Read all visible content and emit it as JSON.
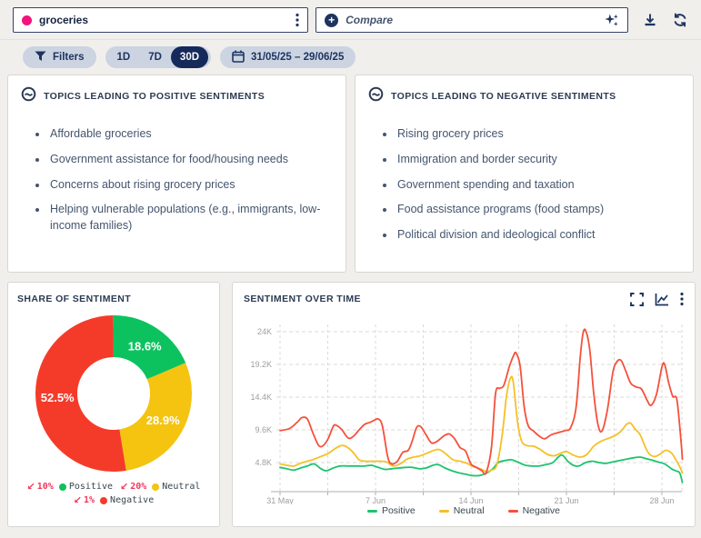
{
  "toolbar": {
    "query": {
      "text": "groceries",
      "dot_color": "#f2137d"
    },
    "compare": {
      "placeholder": "Compare"
    },
    "icons": {
      "query_menu": "kebab-vertical",
      "compare_add": "plus-circle",
      "compare_ai": "sparkles",
      "download": "download-tray",
      "refresh": "refresh-arrows"
    }
  },
  "filters": {
    "filters_label": "Filters",
    "ranges": [
      {
        "label": "1D",
        "active": false
      },
      {
        "label": "7D",
        "active": false
      },
      {
        "label": "30D",
        "active": true
      }
    ],
    "date_range": "31/05/25 – 29/06/25"
  },
  "topics_positive": {
    "title": "TOPICS LEADING TO POSITIVE SENTIMENTS",
    "items": [
      "Affordable groceries",
      "Government assistance for food/housing needs",
      "Concerns about rising grocery prices",
      "Helping vulnerable populations (e.g., immigrants, low-income families)"
    ]
  },
  "topics_negative": {
    "title": "TOPICS LEADING TO NEGATIVE SENTIMENTS",
    "items": [
      "Rising grocery prices",
      "Immigration and border security",
      "Government spending and taxation",
      "Food assistance programs (food stamps)",
      "Political division and ideological conflict"
    ]
  },
  "share_of_sentiment": {
    "title": "SHARE OF SENTIMENT",
    "arrow_glyph": "↙",
    "change_color": "#f5365c",
    "legend": [
      {
        "change": "10%",
        "direction": "down",
        "label": "Positive",
        "color": "#0cc25f"
      },
      {
        "change": "20%",
        "direction": "down",
        "label": "Neutral",
        "color": "#f4c411"
      },
      {
        "change": "1%",
        "direction": "down",
        "label": "Negative",
        "color": "#f43b2a"
      }
    ]
  },
  "sentiment_over_time": {
    "title": "SENTIMENT OVER TIME"
  },
  "chart_data": [
    {
      "type": "pie",
      "variant": "donut",
      "title": "SHARE OF SENTIMENT",
      "value_format": "percent",
      "slices": [
        {
          "label": "Positive",
          "value": 18.6,
          "color": "#0cc25f"
        },
        {
          "label": "Neutral",
          "value": 28.9,
          "color": "#f4c411"
        },
        {
          "label": "Negative",
          "value": 52.5,
          "color": "#f43b2a"
        }
      ],
      "labels_shown": [
        "18.6%",
        "28.9%",
        "52.5%"
      ]
    },
    {
      "type": "line",
      "title": "SENTIMENT OVER TIME",
      "x_unit": "days from 31 May 2025",
      "y_unit": "K mentions",
      "xlim": [
        0,
        29.5
      ],
      "ylim": [
        0.4,
        25.5
      ],
      "grid": "dashed",
      "legend_position": "bottom",
      "x_ticks": [
        {
          "d": 0,
          "label": "31 May"
        },
        {
          "d": 7,
          "label": "7 Jun"
        },
        {
          "d": 14,
          "label": "14 Jun"
        },
        {
          "d": 21,
          "label": "21 Jun"
        },
        {
          "d": 28,
          "label": "28 Jun"
        }
      ],
      "y_ticks": [
        {
          "v": 4.8,
          "label": "4.8K"
        },
        {
          "v": 9.6,
          "label": "9.6K"
        },
        {
          "v": 14.4,
          "label": "14.4K"
        },
        {
          "v": 19.2,
          "label": "19.2K"
        },
        {
          "v": 24,
          "label": "24K"
        }
      ],
      "series": [
        {
          "name": "Positive",
          "color": "#1cc46e",
          "points": [
            [
              0,
              4.1
            ],
            [
              0.5,
              3.9
            ],
            [
              1,
              3.7
            ],
            [
              1.5,
              4.0
            ],
            [
              2,
              4.3
            ],
            [
              2.5,
              4.6
            ],
            [
              3,
              3.9
            ],
            [
              3.4,
              3.6
            ],
            [
              3.9,
              4.0
            ],
            [
              4.4,
              4.3
            ],
            [
              5,
              4.3
            ],
            [
              5.6,
              4.3
            ],
            [
              6.2,
              4.3
            ],
            [
              6.7,
              4.4
            ],
            [
              7.2,
              4.1
            ],
            [
              7.7,
              3.8
            ],
            [
              8.2,
              3.9
            ],
            [
              8.7,
              4.0
            ],
            [
              9.2,
              4.1
            ],
            [
              9.7,
              4.1
            ],
            [
              10.2,
              3.9
            ],
            [
              10.7,
              4.0
            ],
            [
              11.2,
              4.4
            ],
            [
              11.6,
              4.5
            ],
            [
              12.1,
              4.0
            ],
            [
              12.6,
              3.6
            ],
            [
              13.1,
              3.3
            ],
            [
              13.6,
              3.1
            ],
            [
              14.1,
              2.9
            ],
            [
              14.6,
              2.9
            ],
            [
              15.1,
              3.2
            ],
            [
              15.6,
              3.9
            ],
            [
              16,
              4.8
            ],
            [
              16.5,
              5.1
            ],
            [
              17,
              5.2
            ],
            [
              17.5,
              4.8
            ],
            [
              18,
              4.4
            ],
            [
              18.5,
              4.3
            ],
            [
              19,
              4.3
            ],
            [
              19.5,
              4.5
            ],
            [
              20,
              4.8
            ],
            [
              20.4,
              5.6
            ],
            [
              20.7,
              5.9
            ],
            [
              21.1,
              5.0
            ],
            [
              21.5,
              4.4
            ],
            [
              21.9,
              4.3
            ],
            [
              22.4,
              4.8
            ],
            [
              22.9,
              5.0
            ],
            [
              23.4,
              4.8
            ],
            [
              23.9,
              4.7
            ],
            [
              24.4,
              4.9
            ],
            [
              24.9,
              5.1
            ],
            [
              25.4,
              5.3
            ],
            [
              25.9,
              5.5
            ],
            [
              26.4,
              5.6
            ],
            [
              26.8,
              5.4
            ],
            [
              27.2,
              5.2
            ],
            [
              27.7,
              4.9
            ],
            [
              28.2,
              4.6
            ],
            [
              28.7,
              3.9
            ],
            [
              29,
              3.6
            ],
            [
              29.3,
              3.3
            ],
            [
              29.5,
              1.9
            ]
          ]
        },
        {
          "name": "Neutral",
          "color": "#f5c028",
          "points": [
            [
              0,
              4.6
            ],
            [
              0.5,
              4.4
            ],
            [
              1,
              4.3
            ],
            [
              1.5,
              4.7
            ],
            [
              2,
              5.0
            ],
            [
              2.5,
              5.3
            ],
            [
              3,
              5.7
            ],
            [
              3.5,
              6.1
            ],
            [
              4,
              6.8
            ],
            [
              4.5,
              7.3
            ],
            [
              4.9,
              7.1
            ],
            [
              5.4,
              6.2
            ],
            [
              5.8,
              5.2
            ],
            [
              6.3,
              5.0
            ],
            [
              6.8,
              5.0
            ],
            [
              7.3,
              5.0
            ],
            [
              7.8,
              4.9
            ],
            [
              8.3,
              4.3
            ],
            [
              8.8,
              4.6
            ],
            [
              9.3,
              5.3
            ],
            [
              9.8,
              5.6
            ],
            [
              10.3,
              5.8
            ],
            [
              10.8,
              6.2
            ],
            [
              11.3,
              6.6
            ],
            [
              11.7,
              6.7
            ],
            [
              12.2,
              6.0
            ],
            [
              12.7,
              5.2
            ],
            [
              13.2,
              5.0
            ],
            [
              13.7,
              4.7
            ],
            [
              14.2,
              4.2
            ],
            [
              14.7,
              3.9
            ],
            [
              15.1,
              3.5
            ],
            [
              15.5,
              3.7
            ],
            [
              15.9,
              4.5
            ],
            [
              16.3,
              9.0
            ],
            [
              16.6,
              14.5
            ],
            [
              16.9,
              17.2
            ],
            [
              17.1,
              16.6
            ],
            [
              17.4,
              11.0
            ],
            [
              17.7,
              8.0
            ],
            [
              18.1,
              7.3
            ],
            [
              18.6,
              7.2
            ],
            [
              19.1,
              6.7
            ],
            [
              19.6,
              6.0
            ],
            [
              20.1,
              5.8
            ],
            [
              20.6,
              6.2
            ],
            [
              21,
              6.4
            ],
            [
              21.5,
              5.9
            ],
            [
              22,
              5.6
            ],
            [
              22.5,
              6.0
            ],
            [
              23,
              7.2
            ],
            [
              23.5,
              7.9
            ],
            [
              24,
              8.3
            ],
            [
              24.5,
              8.7
            ],
            [
              25,
              9.4
            ],
            [
              25.4,
              10.4
            ],
            [
              25.7,
              10.6
            ],
            [
              26,
              9.8
            ],
            [
              26.4,
              8.9
            ],
            [
              26.8,
              7.0
            ],
            [
              27.1,
              6.0
            ],
            [
              27.5,
              5.7
            ],
            [
              27.9,
              6.1
            ],
            [
              28.3,
              6.6
            ],
            [
              28.7,
              6.2
            ],
            [
              29,
              5.3
            ],
            [
              29.3,
              4.2
            ],
            [
              29.5,
              3.3
            ]
          ]
        },
        {
          "name": "Negative",
          "color": "#f4513b",
          "points": [
            [
              0,
              9.5
            ],
            [
              0.7,
              9.8
            ],
            [
              1.3,
              10.8
            ],
            [
              1.6,
              11.4
            ],
            [
              2,
              11.2
            ],
            [
              2.4,
              9.2
            ],
            [
              2.8,
              7.4
            ],
            [
              3.1,
              7.2
            ],
            [
              3.5,
              8.2
            ],
            [
              3.9,
              10.1
            ],
            [
              4.1,
              10.3
            ],
            [
              4.5,
              9.7
            ],
            [
              5,
              8.4
            ],
            [
              5.4,
              8.7
            ],
            [
              5.8,
              9.6
            ],
            [
              6.2,
              10.4
            ],
            [
              6.6,
              10.7
            ],
            [
              6.9,
              11.0
            ],
            [
              7.2,
              11.2
            ],
            [
              7.5,
              10.2
            ],
            [
              7.9,
              5.6
            ],
            [
              8.2,
              4.6
            ],
            [
              8.6,
              5.0
            ],
            [
              9,
              6.3
            ],
            [
              9.4,
              6.6
            ],
            [
              9.7,
              8.0
            ],
            [
              10,
              9.9
            ],
            [
              10.3,
              10.1
            ],
            [
              10.7,
              8.9
            ],
            [
              11.1,
              7.7
            ],
            [
              11.5,
              7.9
            ],
            [
              12,
              8.7
            ],
            [
              12.4,
              9.0
            ],
            [
              12.8,
              8.3
            ],
            [
              13.2,
              7.0
            ],
            [
              13.6,
              6.5
            ],
            [
              14,
              4.6
            ],
            [
              14.4,
              4.1
            ],
            [
              14.8,
              3.6
            ],
            [
              15.1,
              3.3
            ],
            [
              15.5,
              7.0
            ],
            [
              15.8,
              14.9
            ],
            [
              16.1,
              15.7
            ],
            [
              16.4,
              16.1
            ],
            [
              16.8,
              18.8
            ],
            [
              17.1,
              20.4
            ],
            [
              17.3,
              20.9
            ],
            [
              17.6,
              19.0
            ],
            [
              17.9,
              13.0
            ],
            [
              18.2,
              10.2
            ],
            [
              18.6,
              9.4
            ],
            [
              19,
              8.7
            ],
            [
              19.4,
              8.3
            ],
            [
              19.9,
              8.9
            ],
            [
              20.4,
              9.2
            ],
            [
              20.9,
              9.5
            ],
            [
              21.3,
              9.9
            ],
            [
              21.7,
              12.8
            ],
            [
              22,
              20.0
            ],
            [
              22.2,
              23.6
            ],
            [
              22.4,
              24.2
            ],
            [
              22.7,
              21.5
            ],
            [
              23,
              15.0
            ],
            [
              23.3,
              10.5
            ],
            [
              23.6,
              9.4
            ],
            [
              24,
              12.5
            ],
            [
              24.4,
              18.0
            ],
            [
              24.7,
              19.6
            ],
            [
              25,
              19.8
            ],
            [
              25.3,
              18.5
            ],
            [
              25.7,
              16.5
            ],
            [
              26.1,
              15.9
            ],
            [
              26.5,
              15.6
            ],
            [
              26.9,
              14.0
            ],
            [
              27.2,
              13.2
            ],
            [
              27.6,
              14.8
            ],
            [
              28,
              18.8
            ],
            [
              28.2,
              19.2
            ],
            [
              28.5,
              16.5
            ],
            [
              28.8,
              14.5
            ],
            [
              29.1,
              14.0
            ],
            [
              29.4,
              8.0
            ],
            [
              29.5,
              5.3
            ]
          ]
        }
      ]
    }
  ]
}
